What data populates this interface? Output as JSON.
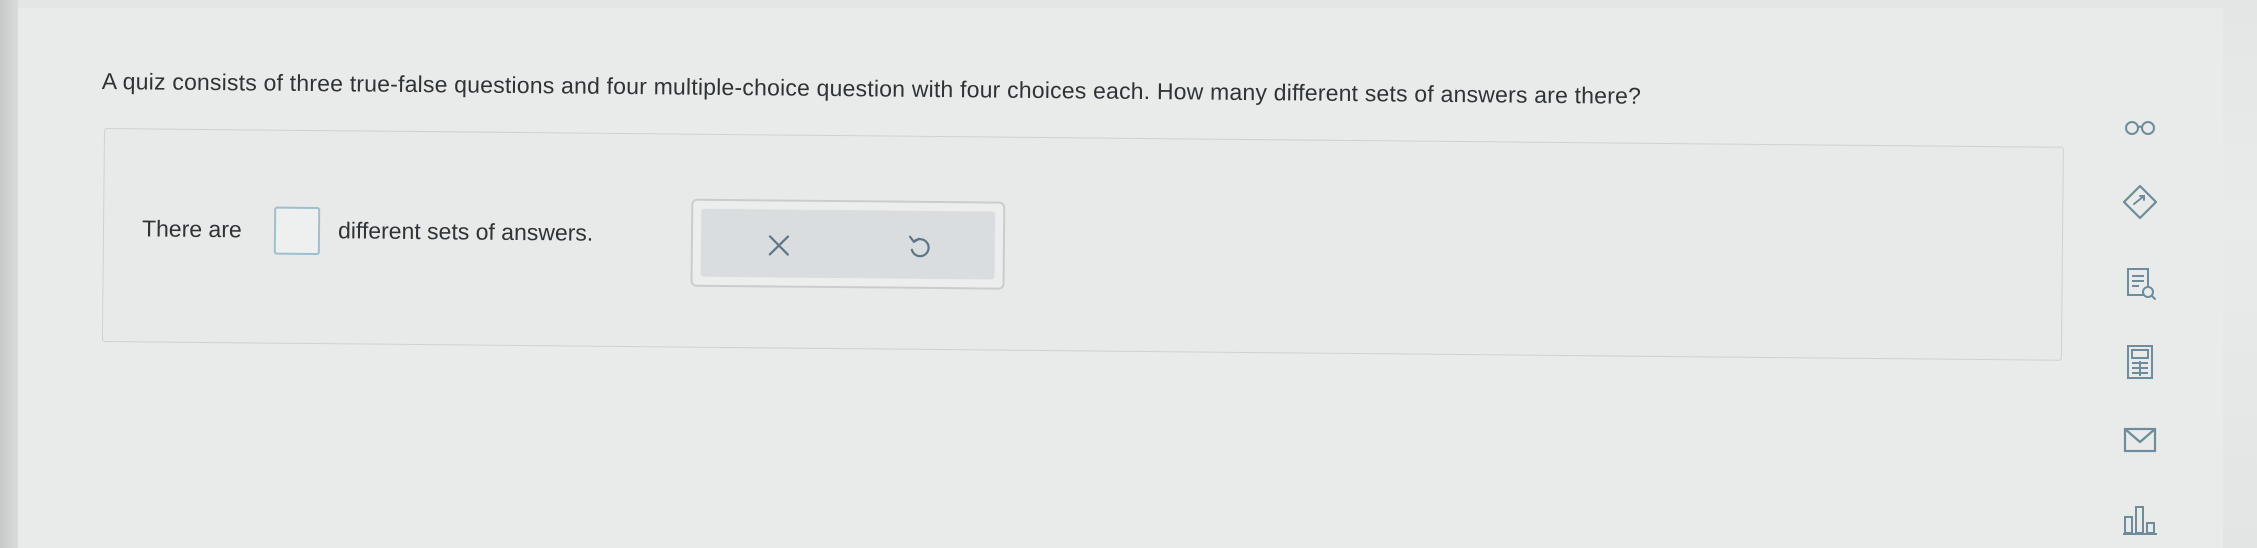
{
  "question": {
    "text": "A quiz consists of three true-false questions and four multiple-choice question with four choices each. How many different sets of answers are there?"
  },
  "answer": {
    "prefix": "There are",
    "input_value": "",
    "suffix": "different sets of answers."
  },
  "actions": {
    "clear_icon": "close-icon",
    "undo_icon": "undo-icon"
  },
  "sidebar": {
    "items": [
      {
        "icon": "glasses-icon"
      },
      {
        "icon": "tag-icon"
      },
      {
        "icon": "textbook-icon"
      },
      {
        "icon": "calculator-icon"
      },
      {
        "icon": "mail-icon"
      },
      {
        "icon": "bar-chart-icon"
      }
    ]
  },
  "colors": {
    "text": "#2e3336",
    "icon": "#6d8c9c",
    "input_border": "#9ebfcf"
  }
}
